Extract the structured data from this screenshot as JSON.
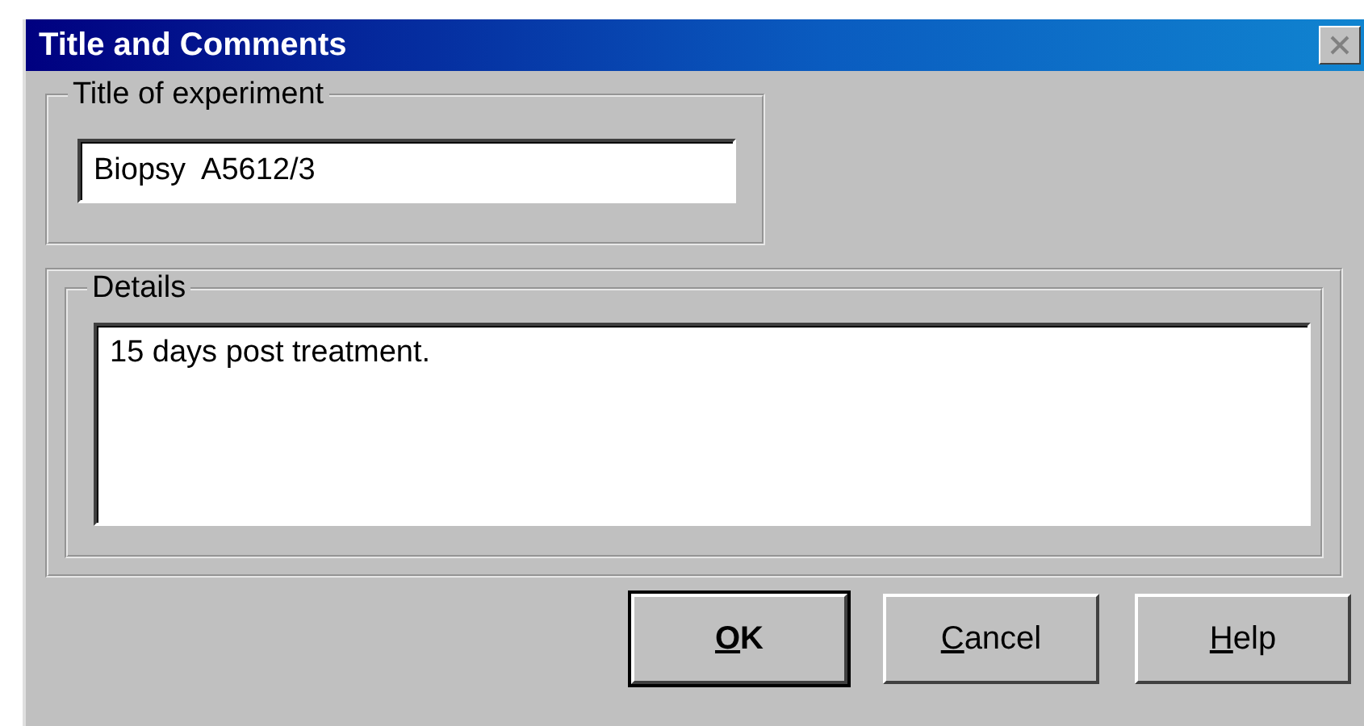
{
  "window": {
    "title": "Title and Comments"
  },
  "title_group": {
    "label": "Title of experiment",
    "value": "Biopsy  A5612/3"
  },
  "details_group": {
    "label": "Details",
    "value": "15 days post treatment."
  },
  "buttons": [
    {
      "label": "OK",
      "default": true
    },
    {
      "label": "Cancel",
      "default": false
    },
    {
      "label": "Help",
      "default": false
    }
  ]
}
